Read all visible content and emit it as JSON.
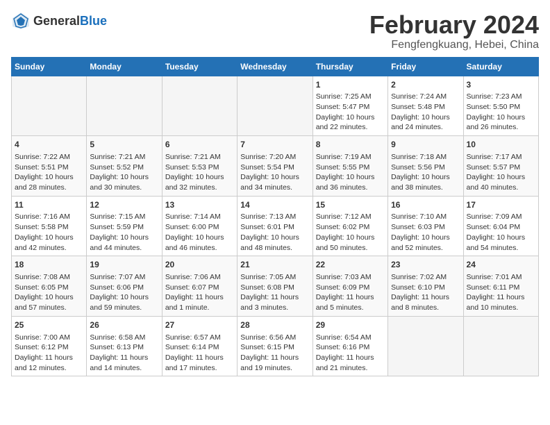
{
  "header": {
    "logo_general": "General",
    "logo_blue": "Blue",
    "title": "February 2024",
    "subtitle": "Fengfengkuang, Hebei, China"
  },
  "weekdays": [
    "Sunday",
    "Monday",
    "Tuesday",
    "Wednesday",
    "Thursday",
    "Friday",
    "Saturday"
  ],
  "weeks": [
    [
      {
        "day": "",
        "info": ""
      },
      {
        "day": "",
        "info": ""
      },
      {
        "day": "",
        "info": ""
      },
      {
        "day": "",
        "info": ""
      },
      {
        "day": "1",
        "info": "Sunrise: 7:25 AM\nSunset: 5:47 PM\nDaylight: 10 hours and 22 minutes."
      },
      {
        "day": "2",
        "info": "Sunrise: 7:24 AM\nSunset: 5:48 PM\nDaylight: 10 hours and 24 minutes."
      },
      {
        "day": "3",
        "info": "Sunrise: 7:23 AM\nSunset: 5:50 PM\nDaylight: 10 hours and 26 minutes."
      }
    ],
    [
      {
        "day": "4",
        "info": "Sunrise: 7:22 AM\nSunset: 5:51 PM\nDaylight: 10 hours and 28 minutes."
      },
      {
        "day": "5",
        "info": "Sunrise: 7:21 AM\nSunset: 5:52 PM\nDaylight: 10 hours and 30 minutes."
      },
      {
        "day": "6",
        "info": "Sunrise: 7:21 AM\nSunset: 5:53 PM\nDaylight: 10 hours and 32 minutes."
      },
      {
        "day": "7",
        "info": "Sunrise: 7:20 AM\nSunset: 5:54 PM\nDaylight: 10 hours and 34 minutes."
      },
      {
        "day": "8",
        "info": "Sunrise: 7:19 AM\nSunset: 5:55 PM\nDaylight: 10 hours and 36 minutes."
      },
      {
        "day": "9",
        "info": "Sunrise: 7:18 AM\nSunset: 5:56 PM\nDaylight: 10 hours and 38 minutes."
      },
      {
        "day": "10",
        "info": "Sunrise: 7:17 AM\nSunset: 5:57 PM\nDaylight: 10 hours and 40 minutes."
      }
    ],
    [
      {
        "day": "11",
        "info": "Sunrise: 7:16 AM\nSunset: 5:58 PM\nDaylight: 10 hours and 42 minutes."
      },
      {
        "day": "12",
        "info": "Sunrise: 7:15 AM\nSunset: 5:59 PM\nDaylight: 10 hours and 44 minutes."
      },
      {
        "day": "13",
        "info": "Sunrise: 7:14 AM\nSunset: 6:00 PM\nDaylight: 10 hours and 46 minutes."
      },
      {
        "day": "14",
        "info": "Sunrise: 7:13 AM\nSunset: 6:01 PM\nDaylight: 10 hours and 48 minutes."
      },
      {
        "day": "15",
        "info": "Sunrise: 7:12 AM\nSunset: 6:02 PM\nDaylight: 10 hours and 50 minutes."
      },
      {
        "day": "16",
        "info": "Sunrise: 7:10 AM\nSunset: 6:03 PM\nDaylight: 10 hours and 52 minutes."
      },
      {
        "day": "17",
        "info": "Sunrise: 7:09 AM\nSunset: 6:04 PM\nDaylight: 10 hours and 54 minutes."
      }
    ],
    [
      {
        "day": "18",
        "info": "Sunrise: 7:08 AM\nSunset: 6:05 PM\nDaylight: 10 hours and 57 minutes."
      },
      {
        "day": "19",
        "info": "Sunrise: 7:07 AM\nSunset: 6:06 PM\nDaylight: 10 hours and 59 minutes."
      },
      {
        "day": "20",
        "info": "Sunrise: 7:06 AM\nSunset: 6:07 PM\nDaylight: 11 hours and 1 minute."
      },
      {
        "day": "21",
        "info": "Sunrise: 7:05 AM\nSunset: 6:08 PM\nDaylight: 11 hours and 3 minutes."
      },
      {
        "day": "22",
        "info": "Sunrise: 7:03 AM\nSunset: 6:09 PM\nDaylight: 11 hours and 5 minutes."
      },
      {
        "day": "23",
        "info": "Sunrise: 7:02 AM\nSunset: 6:10 PM\nDaylight: 11 hours and 8 minutes."
      },
      {
        "day": "24",
        "info": "Sunrise: 7:01 AM\nSunset: 6:11 PM\nDaylight: 11 hours and 10 minutes."
      }
    ],
    [
      {
        "day": "25",
        "info": "Sunrise: 7:00 AM\nSunset: 6:12 PM\nDaylight: 11 hours and 12 minutes."
      },
      {
        "day": "26",
        "info": "Sunrise: 6:58 AM\nSunset: 6:13 PM\nDaylight: 11 hours and 14 minutes."
      },
      {
        "day": "27",
        "info": "Sunrise: 6:57 AM\nSunset: 6:14 PM\nDaylight: 11 hours and 17 minutes."
      },
      {
        "day": "28",
        "info": "Sunrise: 6:56 AM\nSunset: 6:15 PM\nDaylight: 11 hours and 19 minutes."
      },
      {
        "day": "29",
        "info": "Sunrise: 6:54 AM\nSunset: 6:16 PM\nDaylight: 11 hours and 21 minutes."
      },
      {
        "day": "",
        "info": ""
      },
      {
        "day": "",
        "info": ""
      }
    ]
  ]
}
